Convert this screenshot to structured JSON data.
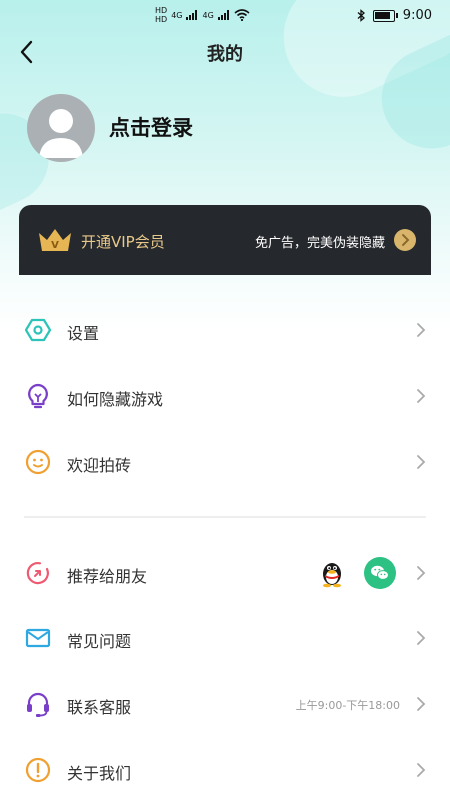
{
  "status_bar": {
    "network_1": "HD",
    "network_2": "HD",
    "signal_1": "4G",
    "signal_2": "4G",
    "time": "9:00"
  },
  "header": {
    "title": "我的"
  },
  "profile": {
    "login_text": "点击登录"
  },
  "vip": {
    "title": "开通VIP会员",
    "description": "免广告，完美伪装隐藏",
    "accent_color": "#d9b56c"
  },
  "menu_group_1": [
    {
      "label": "设置",
      "icon": "gear-hexagon-icon"
    },
    {
      "label": "如何隐藏游戏",
      "icon": "lightbulb-icon"
    },
    {
      "label": "欢迎拍砖",
      "icon": "smile-icon"
    }
  ],
  "menu_group_2": [
    {
      "label": "推荐给朋友",
      "icon": "share-icon"
    },
    {
      "label": "常见问题",
      "icon": "mail-icon"
    },
    {
      "label": "联系客服",
      "icon": "headset-icon",
      "extra": "上午9:00-下午18:00"
    },
    {
      "label": "关于我们",
      "icon": "info-icon"
    }
  ]
}
